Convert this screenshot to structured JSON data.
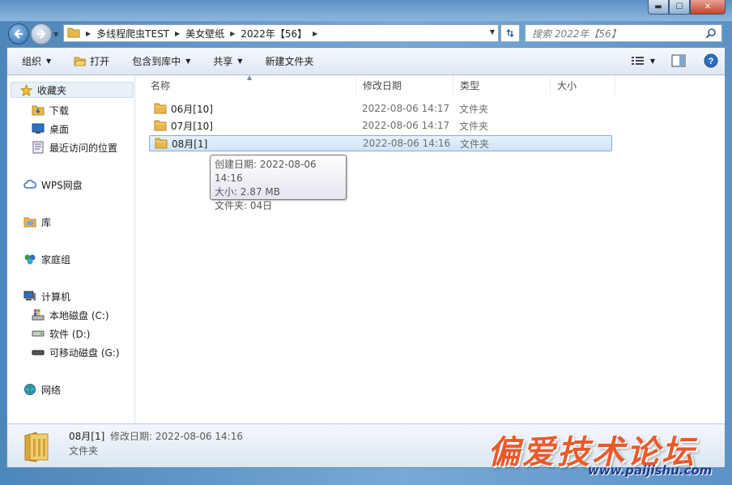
{
  "window_controls": {
    "minimize": "▬",
    "maximize": "☐",
    "close": "✕"
  },
  "address": {
    "crumbs": [
      "多线程爬虫TEST",
      "美女壁纸",
      "2022年【56】"
    ]
  },
  "search": {
    "placeholder": "搜索 2022年【56】"
  },
  "toolbar": {
    "organize": "组织",
    "open": "打开",
    "include_in_library": "包含到库中",
    "share": "共享",
    "new_folder": "新建文件夹"
  },
  "sidebar": {
    "favorites": "收藏夹",
    "downloads": "下载",
    "desktop": "桌面",
    "recent": "最近访问的位置",
    "wps": "WPS网盘",
    "libraries": "库",
    "homegroup": "家庭组",
    "computer": "计算机",
    "drive_c": "本地磁盘 (C:)",
    "drive_d": "软件 (D:)",
    "drive_g": "可移动磁盘 (G:)",
    "network": "网络"
  },
  "columns": {
    "name": "名称",
    "modified": "修改日期",
    "type": "类型",
    "size": "大小"
  },
  "files": [
    {
      "name": "06月[10]",
      "modified": "2022-08-06 14:17",
      "type": "文件夹",
      "selected": false
    },
    {
      "name": "07月[10]",
      "modified": "2022-08-06 14:17",
      "type": "文件夹",
      "selected": false
    },
    {
      "name": "08月[1]",
      "modified": "2022-08-06 14:16",
      "type": "文件夹",
      "selected": true
    }
  ],
  "tooltip": {
    "created": "创建日期: 2022-08-06 14:16",
    "size": "大小: 2.87 MB",
    "folders": "文件夹: 04日"
  },
  "details": {
    "name": "08月[1]",
    "modified": "修改日期: 2022-08-06 14:16",
    "type": "文件夹"
  },
  "watermark": {
    "title": "偏爱技术论坛",
    "url": "www.paijishu.com"
  },
  "colors": {
    "selection": "#cfe4f8",
    "folder": "#e8b84a",
    "accent": "#2d6aa8"
  }
}
